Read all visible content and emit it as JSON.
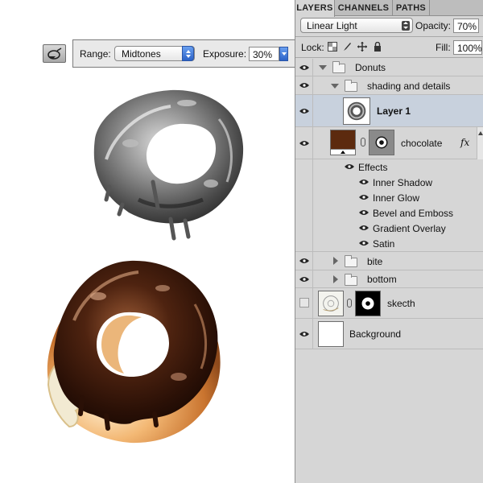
{
  "options_bar": {
    "range_label": "Range:",
    "range_value": "Midtones",
    "exposure_label": "Exposure:",
    "exposure_value": "30%"
  },
  "tool_icon": "burn-tool-icon",
  "panel": {
    "tabs": [
      "LAYERS",
      "CHANNELS",
      "PATHS"
    ],
    "active_tab": "LAYERS",
    "blend_mode": "Linear Light",
    "opacity_label": "Opacity:",
    "opacity_value": "70%",
    "lock_label": "Lock:",
    "fill_label": "Fill:",
    "fill_value": "100%",
    "layers": {
      "donuts": "Donuts",
      "shading": "shading and details",
      "layer1": "Layer 1",
      "chocolate": "chocolate",
      "fx": "fx",
      "effects_label": "Effects",
      "effects": [
        "Inner Shadow",
        "Inner Glow",
        "Bevel and Emboss",
        "Gradient Overlay",
        "Satin"
      ],
      "bite": "bite",
      "bottom": "bottom",
      "skecth": "skecth",
      "background": "Background"
    }
  },
  "colors": {
    "chocolate_swatch": "#5c2a0e",
    "selected_row": "#c8d1dd",
    "panel_bg": "#d6d6d6"
  }
}
